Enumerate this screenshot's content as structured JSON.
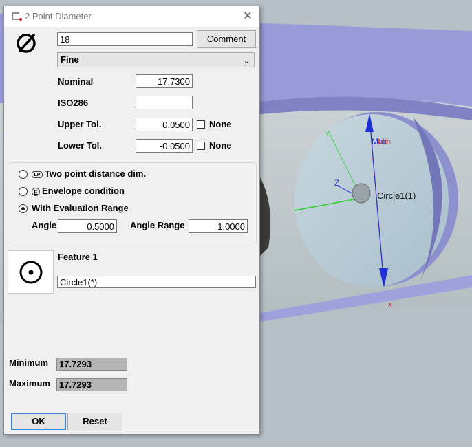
{
  "dialog": {
    "title": "2 Point Diameter",
    "close_symbol": "✕",
    "diameter_icon": "diameter-icon",
    "value_field": "18",
    "comment_label": "Comment",
    "grade_select": "Fine",
    "nominal": {
      "label": "Nominal",
      "value": "17.7300"
    },
    "iso286": {
      "label": "ISO286",
      "value": ""
    },
    "upper_tol": {
      "label": "Upper Tol.",
      "value": "0.0500",
      "none_label": "None"
    },
    "lower_tol": {
      "label": "Lower Tol.",
      "value": "-0.0500",
      "none_label": "None"
    },
    "options": {
      "two_point": {
        "label": "Two point distance dim.",
        "badge": "LP"
      },
      "envelope": {
        "label": "Envelope condition",
        "badge": "E"
      },
      "evaluation": {
        "label": "With Evaluation Range"
      }
    },
    "angle": {
      "label": "Angle",
      "value": "0.5000"
    },
    "angle_range": {
      "label": "Angle Range",
      "value": "1.0000"
    },
    "feature": {
      "label": "Feature 1",
      "value": "Circle1(*)"
    },
    "minimum": {
      "label": "Minimum",
      "value": "17.7293"
    },
    "maximum": {
      "label": "Maximum",
      "value": "17.7293"
    },
    "ok_label": "OK",
    "reset_label": "Reset"
  },
  "scene": {
    "labels": {
      "max": "Max",
      "min": "Min",
      "circle": "Circle1(1)",
      "axis_z": "Z",
      "axis_x": "x",
      "axis_y": "Y"
    },
    "colors": {
      "ring": "#8f93cf",
      "ring_dark": "#6f73b5",
      "body": "#c4cccf",
      "hole": "#b7cad6",
      "measure": "#1f2fd8",
      "accent": "#d02020"
    }
  }
}
